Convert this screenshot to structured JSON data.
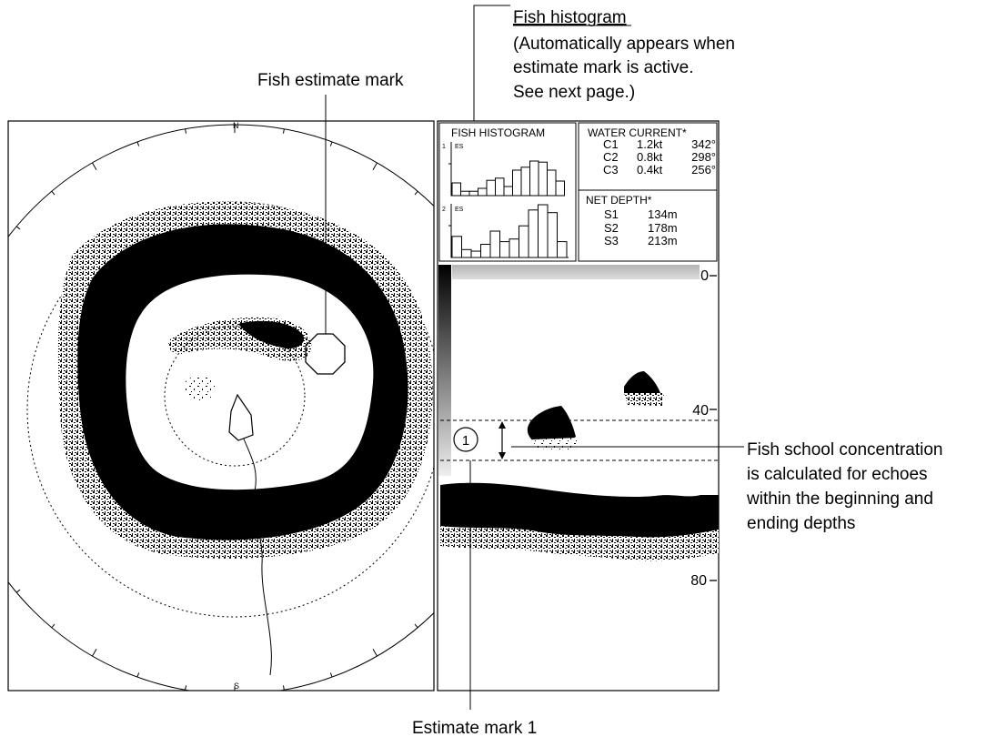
{
  "callouts": {
    "fish_histogram_title": "Fish histogram",
    "fish_histogram_note_1": "(Automatically appears when",
    "fish_histogram_note_2": "estimate mark is active.",
    "fish_histogram_note_3": "See next page.)",
    "fish_estimate_mark": "Fish estimate mark",
    "concentration_1": "Fish school concentration",
    "concentration_2": "is calculated for echoes",
    "concentration_3": "within the beginning and",
    "concentration_4": "ending depths",
    "estimate_mark_1": "Estimate mark 1"
  },
  "sonar": {
    "north_label": "N",
    "south_label": "S"
  },
  "histogram_panel": {
    "title": "FISH HISTOGRAM",
    "row1_index": "1",
    "row1_tag": "ES",
    "row2_index": "2",
    "row2_tag": "ES",
    "row1_bars": [
      0.35,
      0.12,
      0.12,
      0.2,
      0.42,
      0.48,
      0.25,
      0.7,
      0.78,
      0.95,
      0.92,
      0.7,
      0.4
    ],
    "row2_bars": [
      0.4,
      0.15,
      0.12,
      0.25,
      0.5,
      0.3,
      0.35,
      0.6,
      0.9,
      1.0,
      0.85,
      0.3
    ]
  },
  "water_current": {
    "title": "WATER CURRENT*",
    "rows": [
      {
        "id": "C1",
        "speed": "1.2kt",
        "dir": "342°"
      },
      {
        "id": "C2",
        "speed": "0.8kt",
        "dir": "298°"
      },
      {
        "id": "C3",
        "speed": "0.4kt",
        "dir": "256°"
      }
    ]
  },
  "net_depth": {
    "title": "NET DEPTH*",
    "rows": [
      {
        "id": "S1",
        "depth": "134m"
      },
      {
        "id": "S2",
        "depth": "178m"
      },
      {
        "id": "S3",
        "depth": "213m"
      }
    ]
  },
  "echo": {
    "depth_labels": [
      "0",
      "40",
      "80"
    ],
    "estimate_mark_number": "1"
  },
  "colors": {
    "ink": "#000000",
    "background": "#ffffff",
    "panel_grey": "#c8c8c8"
  }
}
